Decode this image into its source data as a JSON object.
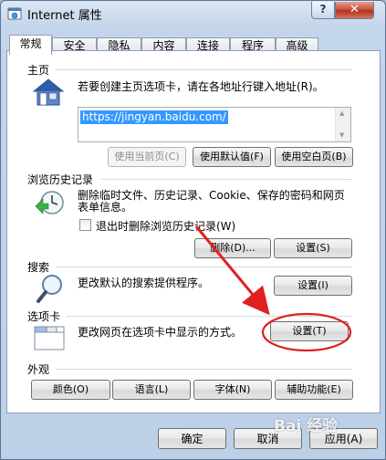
{
  "window": {
    "title": "Internet 属性",
    "help_label": "?",
    "close_label": "✕"
  },
  "tabs": [
    {
      "label": "常规",
      "active": true
    },
    {
      "label": "安全"
    },
    {
      "label": "隐私"
    },
    {
      "label": "内容"
    },
    {
      "label": "连接"
    },
    {
      "label": "程序"
    },
    {
      "label": "高级"
    }
  ],
  "home": {
    "section_label": "主页",
    "description": "若要创建主页选项卡，请在各地址行键入地址(R)。",
    "url": "https://jingyan.baidu.com/",
    "use_current": "使用当前页(C)",
    "use_default": "使用默认值(F)",
    "use_blank": "使用空白页(B)"
  },
  "history": {
    "section_label": "浏览历史记录",
    "description_line1": "删除临时文件、历史记录、Cookie、保存的密码和网页",
    "description_line2": "表单信息。",
    "checkbox_label": "退出时删除浏览历史记录(W)",
    "delete_button": "删除(D)...",
    "settings_button": "设置(S)"
  },
  "search": {
    "section_label": "搜索",
    "description": "更改默认的搜索提供程序。",
    "settings_button": "设置(I)"
  },
  "tabs_section": {
    "section_label": "选项卡",
    "description": "更改网页在选项卡中显示的方式。",
    "settings_button": "设置(T)"
  },
  "appearance": {
    "section_label": "外观",
    "colors_button": "颜色(O)",
    "languages_button": "语言(L)",
    "fonts_button": "字体(N)",
    "accessibility_button": "辅助功能(E)"
  },
  "footer": {
    "ok_button": "确定",
    "cancel_button": "取消",
    "apply_button": "应用(A)"
  },
  "watermark": "Bai 经验",
  "colors": {
    "annotation_red": "#e02020",
    "selection_blue": "#3399ff"
  }
}
